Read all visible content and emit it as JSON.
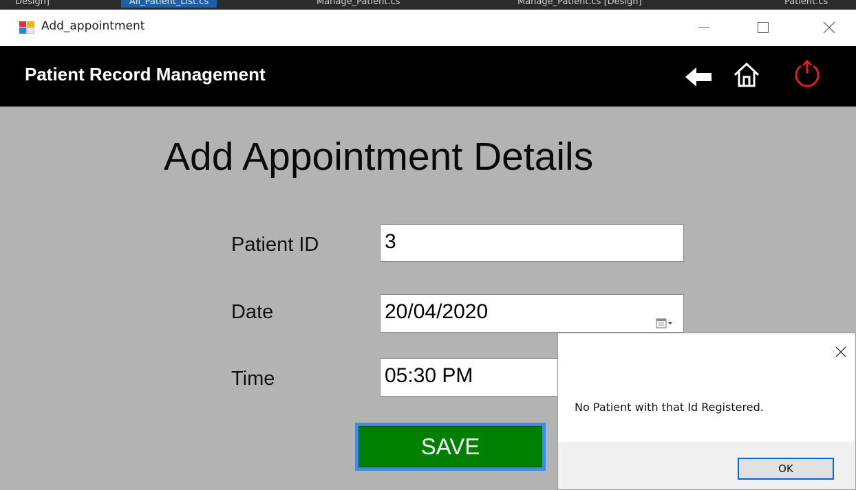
{
  "ide_tabs": [
    {
      "label": "Design]"
    },
    {
      "label": "All_Patient_List.cs"
    },
    {
      "label": "Manage_Patient.cs"
    },
    {
      "label": "Manage_Patient.cs [Design]"
    },
    {
      "label": "Patient.cs"
    }
  ],
  "window": {
    "title": "Add_appointment",
    "icon": "winforms-app-icon"
  },
  "header": {
    "app_name": "Patient Record Management",
    "icons": [
      "back-arrow-icon",
      "home-icon",
      "power-icon"
    ],
    "power_color": "#e0201b"
  },
  "form": {
    "title": "Add Appointment Details",
    "patient_id_label": "Patient ID",
    "patient_id_value": "3",
    "date_label": "Date",
    "date_value": "20/04/2020",
    "time_label": "Time",
    "time_value": "05:30 PM",
    "save_label": "SAVE",
    "save_color": "#008000"
  },
  "message_box": {
    "text": "No Patient with that Id Registered.",
    "ok_label": "OK"
  }
}
